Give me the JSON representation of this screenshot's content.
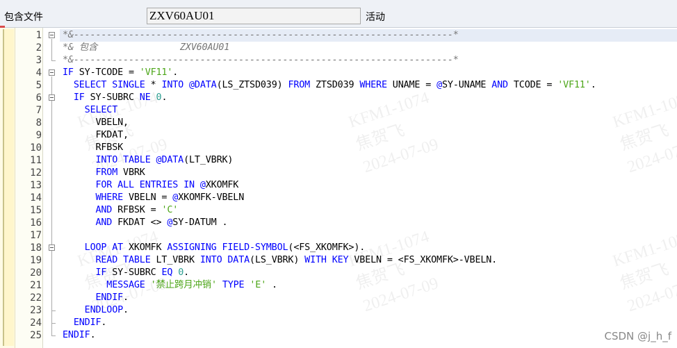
{
  "header": {
    "include_label": "包含文件",
    "include_value": "ZXV60AU01",
    "status": "活动"
  },
  "watermark_lines": [
    "KFM1-1074",
    "焦贺飞",
    "2024-07-09"
  ],
  "csdn_mark": "CSDN @j_h_f",
  "lines": [
    {
      "n": "1",
      "t": [
        [
          "com",
          "*&---------------------------------------------------------------------*"
        ]
      ]
    },
    {
      "n": "2",
      "t": [
        [
          "com",
          "*& 包含               ZXV60AU01"
        ]
      ]
    },
    {
      "n": "3",
      "t": [
        [
          "com",
          "*&---------------------------------------------------------------------*"
        ]
      ]
    },
    {
      "n": "4",
      "t": [
        [
          "kw",
          "IF"
        ],
        [
          "op",
          " SY-TCODE = "
        ],
        [
          "str",
          "'VF11'"
        ],
        [
          "op",
          "."
        ]
      ]
    },
    {
      "n": "5",
      "t": [
        [
          "op",
          "  "
        ],
        [
          "kw",
          "SELECT SINGLE"
        ],
        [
          "op",
          " * "
        ],
        [
          "kw",
          "INTO"
        ],
        [
          "op",
          " "
        ],
        [
          "kw",
          "@DATA"
        ],
        [
          "op",
          "(LS_ZTSD039) "
        ],
        [
          "kw",
          "FROM"
        ],
        [
          "op",
          " ZTSD039 "
        ],
        [
          "kw",
          "WHERE"
        ],
        [
          "op",
          " UNAME = "
        ],
        [
          "kw",
          "@"
        ],
        [
          "op",
          "SY-UNAME "
        ],
        [
          "kw",
          "AND"
        ],
        [
          "op",
          " TCODE = "
        ],
        [
          "str",
          "'VF11'"
        ],
        [
          "op",
          "."
        ]
      ]
    },
    {
      "n": "6",
      "t": [
        [
          "op",
          "  "
        ],
        [
          "kw",
          "IF"
        ],
        [
          "op",
          " SY-SUBRC "
        ],
        [
          "kw",
          "NE"
        ],
        [
          "op",
          " "
        ],
        [
          "num",
          "0"
        ],
        [
          "op",
          "."
        ]
      ]
    },
    {
      "n": "7",
      "t": [
        [
          "op",
          "    "
        ],
        [
          "kw",
          "SELECT"
        ]
      ]
    },
    {
      "n": "8",
      "t": [
        [
          "op",
          "      VBELN,"
        ]
      ]
    },
    {
      "n": "9",
      "t": [
        [
          "op",
          "      FKDAT,"
        ]
      ]
    },
    {
      "n": "10",
      "t": [
        [
          "op",
          "      RFBSK"
        ]
      ]
    },
    {
      "n": "11",
      "t": [
        [
          "op",
          "      "
        ],
        [
          "kw",
          "INTO TABLE"
        ],
        [
          "op",
          " "
        ],
        [
          "kw",
          "@DATA"
        ],
        [
          "op",
          "(LT_VBRK)"
        ]
      ]
    },
    {
      "n": "12",
      "t": [
        [
          "op",
          "      "
        ],
        [
          "kw",
          "FROM"
        ],
        [
          "op",
          " VBRK"
        ]
      ]
    },
    {
      "n": "13",
      "t": [
        [
          "op",
          "      "
        ],
        [
          "kw",
          "FOR ALL ENTRIES IN"
        ],
        [
          "op",
          " "
        ],
        [
          "kw",
          "@"
        ],
        [
          "op",
          "XKOMFK"
        ]
      ]
    },
    {
      "n": "14",
      "t": [
        [
          "op",
          "      "
        ],
        [
          "kw",
          "WHERE"
        ],
        [
          "op",
          " VBELN = "
        ],
        [
          "kw",
          "@"
        ],
        [
          "op",
          "XKOMFK-VBELN"
        ]
      ]
    },
    {
      "n": "15",
      "t": [
        [
          "op",
          "      "
        ],
        [
          "kw",
          "AND"
        ],
        [
          "op",
          " RFBSK = "
        ],
        [
          "str",
          "'C'"
        ]
      ]
    },
    {
      "n": "16",
      "t": [
        [
          "op",
          "      "
        ],
        [
          "kw",
          "AND"
        ],
        [
          "op",
          " FKDAT <> "
        ],
        [
          "kw",
          "@"
        ],
        [
          "op",
          "SY-DATUM ."
        ]
      ]
    },
    {
      "n": "17",
      "t": [
        [
          "op",
          ""
        ]
      ]
    },
    {
      "n": "18",
      "t": [
        [
          "op",
          "    "
        ],
        [
          "kw",
          "LOOP AT"
        ],
        [
          "op",
          " XKOMFK "
        ],
        [
          "kw",
          "ASSIGNING FIELD-SYMBOL"
        ],
        [
          "op",
          "(<FS_XKOMFK>)."
        ]
      ]
    },
    {
      "n": "19",
      "t": [
        [
          "op",
          "      "
        ],
        [
          "kw",
          "READ TABLE"
        ],
        [
          "op",
          " LT_VBRK "
        ],
        [
          "kw",
          "INTO DATA"
        ],
        [
          "op",
          "(LS_VBRK) "
        ],
        [
          "kw",
          "WITH KEY"
        ],
        [
          "op",
          " VBELN = <FS_XKOMFK>-VBELN."
        ]
      ]
    },
    {
      "n": "20",
      "t": [
        [
          "op",
          "      "
        ],
        [
          "kw",
          "IF"
        ],
        [
          "op",
          " SY-SUBRC "
        ],
        [
          "kw",
          "EQ"
        ],
        [
          "op",
          " "
        ],
        [
          "num",
          "0"
        ],
        [
          "op",
          "."
        ]
      ]
    },
    {
      "n": "21",
      "t": [
        [
          "op",
          "        "
        ],
        [
          "kw",
          "MESSAGE"
        ],
        [
          "op",
          " "
        ],
        [
          "str",
          "'禁止跨月冲销'"
        ],
        [
          "op",
          " "
        ],
        [
          "kw",
          "TYPE"
        ],
        [
          "op",
          " "
        ],
        [
          "str",
          "'E'"
        ],
        [
          "op",
          " ."
        ]
      ]
    },
    {
      "n": "22",
      "t": [
        [
          "op",
          "      "
        ],
        [
          "kw",
          "ENDIF"
        ],
        [
          "op",
          "."
        ]
      ]
    },
    {
      "n": "23",
      "t": [
        [
          "op",
          "    "
        ],
        [
          "kw",
          "ENDLOOP"
        ],
        [
          "op",
          "."
        ]
      ]
    },
    {
      "n": "24",
      "t": [
        [
          "op",
          "  "
        ],
        [
          "kw",
          "ENDIF"
        ],
        [
          "op",
          "."
        ]
      ]
    },
    {
      "n": "25",
      "t": [
        [
          "kw",
          "ENDIF"
        ],
        [
          "op",
          "."
        ]
      ]
    }
  ]
}
